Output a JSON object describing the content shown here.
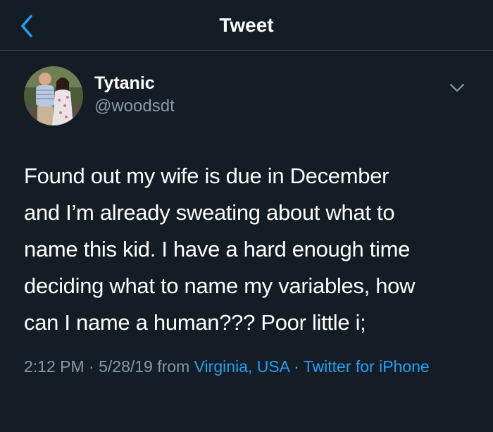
{
  "nav": {
    "title": "Tweet",
    "back_icon": "chevron-left-icon"
  },
  "author": {
    "display_name": "Tytanic",
    "username": "@woodsdt"
  },
  "tweet": {
    "lines": [
      "Found out my wife is due in December",
      "and I’m already sweating about what to",
      "name this kid.  I have a hard enough time",
      "deciding what to name my variables, how",
      "can I name a human??? Poor little i;"
    ]
  },
  "meta": {
    "time_date": "2:12 PM · 5/28/19 from ",
    "location": "Virginia, USA",
    "separator": " · ",
    "client": "Twitter for iPhone"
  },
  "colors": {
    "background": "#141d26",
    "accent": "#1da1f2",
    "secondary_text": "#8899a6",
    "divider": "#38444d"
  },
  "icons": {
    "options": "chevron-down-icon"
  }
}
